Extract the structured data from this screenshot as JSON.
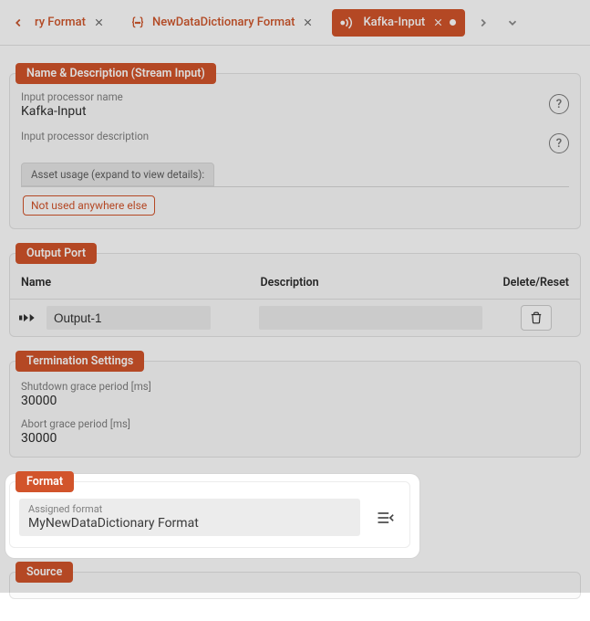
{
  "tabs": {
    "left_fragment": "ry Format",
    "middle": "NewDataDictionary Format",
    "active": "Kafka-Input"
  },
  "name_desc": {
    "header": "Name & Description (Stream Input)",
    "name_label": "Input processor name",
    "name_value": "Kafka-Input",
    "desc_label": "Input processor description",
    "usage_label": "Asset usage (expand to view details):",
    "usage_chip": "Not used anywhere else"
  },
  "output_port": {
    "header": "Output Port",
    "cols": {
      "name": "Name",
      "desc": "Description",
      "del": "Delete/Reset"
    },
    "rows": [
      {
        "name": "Output-1",
        "desc": ""
      }
    ]
  },
  "termination": {
    "header": "Termination Settings",
    "shutdown_label": "Shutdown grace period [ms]",
    "shutdown_value": "30000",
    "abort_label": "Abort grace period [ms]",
    "abort_value": "30000"
  },
  "format": {
    "header": "Format",
    "label": "Assigned format",
    "value": "MyNewDataDictionary Format"
  },
  "source": {
    "header": "Source"
  }
}
